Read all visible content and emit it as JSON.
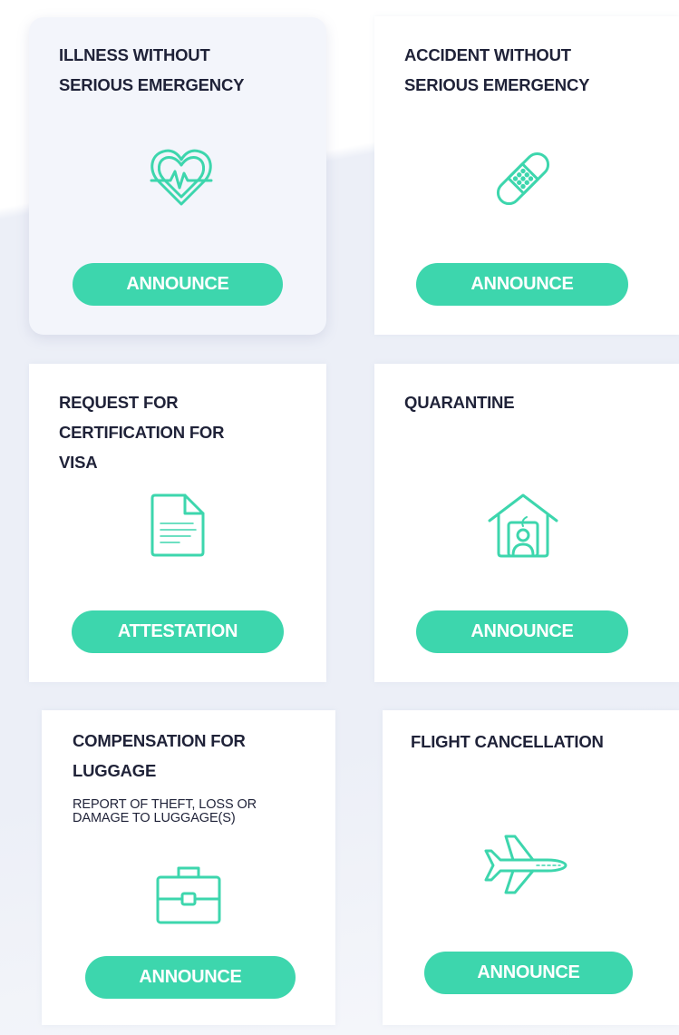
{
  "accent_color": "#3dd6ad",
  "cards": [
    {
      "title": "ILLNESS WITHOUT\nSERIOUS EMERGENCY",
      "icon": "heartbeat-icon",
      "button_label": "ANNOUNCE"
    },
    {
      "title": "ACCIDENT WITHOUT\nSERIOUS EMERGENCY",
      "icon": "bandage-icon",
      "button_label": "ANNOUNCE"
    },
    {
      "title": "REQUEST FOR\nCERTIFICATION FOR\nVISA",
      "icon": "document-icon",
      "button_label": "ATTESTATION"
    },
    {
      "title": "QUARANTINE",
      "icon": "home-person-icon",
      "button_label": "ANNOUNCE"
    },
    {
      "title": "COMPENSATION FOR\nLUGGAGE",
      "subtitle": "REPORT OF THEFT, LOSS OR\nDAMAGE TO LUGGAGE(S)",
      "icon": "briefcase-icon",
      "button_label": "ANNOUNCE"
    },
    {
      "title": "FLIGHT CANCELLATION",
      "icon": "airplane-icon",
      "button_label": "ANNOUNCE"
    }
  ]
}
